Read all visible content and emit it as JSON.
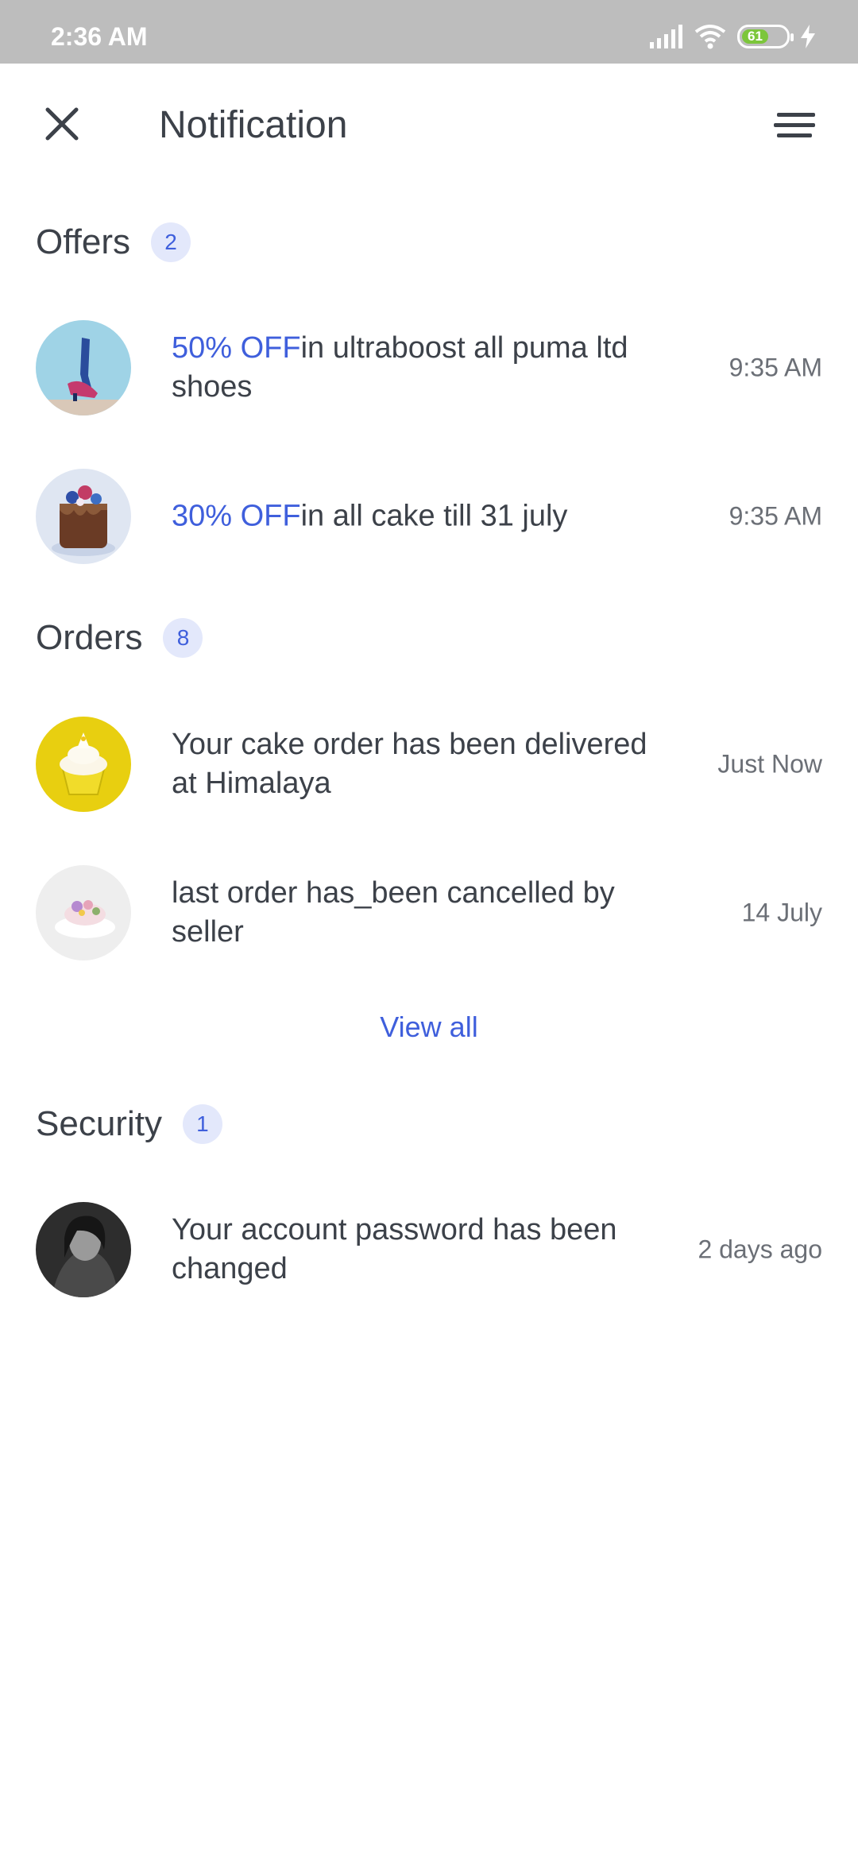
{
  "status_bar": {
    "time": "2:36 AM",
    "battery": "61"
  },
  "header": {
    "title": "Notification"
  },
  "sections": {
    "offers": {
      "title": "Offers",
      "count": "2",
      "items": [
        {
          "highlight": "50% OFF",
          "text": "in ultraboost all puma ltd shoes",
          "time": "9:35 AM"
        },
        {
          "highlight": "30% OFF",
          "text": "in all cake till 31 july",
          "time": "9:35 AM"
        }
      ]
    },
    "orders": {
      "title": "Orders",
      "count": "8",
      "items": [
        {
          "text": "Your cake order has been delivered at Himalaya",
          "time": "Just Now"
        },
        {
          "text": "last order has_been cancelled by seller",
          "time": "14 July"
        }
      ],
      "view_all": "View all"
    },
    "security": {
      "title": "Security",
      "count": "1",
      "items": [
        {
          "text": "Your account password has been changed",
          "time": "2 days ago"
        }
      ]
    }
  },
  "colors": {
    "accent": "#3f5fdc",
    "badge_bg": "#e3e8fb",
    "statusbar": "#bdbdbd",
    "text": "#3c4149"
  },
  "icons": [
    "close-icon",
    "filter-menu-icon",
    "signal-icon",
    "wifi-icon",
    "battery-icon",
    "charging-icon"
  ]
}
